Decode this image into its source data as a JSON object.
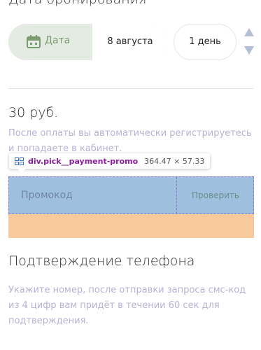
{
  "booking": {
    "title": "Дата бронирования",
    "date_tag_label": "Дата",
    "date_value": "8 августа",
    "days_value": "1 день"
  },
  "payment": {
    "price": "30 руб.",
    "after_pay_note": "После оплаты вы автоматически регистрируетесь и попадаете в кабинет.",
    "promo_placeholder": "Промокод",
    "check_label": "Проверить"
  },
  "inspector_tooltip": {
    "selector": "div.pick__payment-promo",
    "size": "364.47 × 57.33"
  },
  "phone": {
    "title": "Подтверждение телефона",
    "description": "Укажите номер, после отправки запроса смс-код из 4 цифр вам придёт в течении 60 сек для подтверждения."
  },
  "colors": {
    "date_accent": "#7c9b73",
    "muted_text": "#b6b3d4",
    "promo_highlight": "#9fbfdf",
    "margin_highlight": "#f8c99a",
    "selector_text": "#8a1d9b"
  },
  "icons": {
    "calendar": "calendar-icon",
    "stepper_up": "chevron-up-icon",
    "stepper_down": "chevron-down-icon",
    "inspector": "grid-icon"
  }
}
